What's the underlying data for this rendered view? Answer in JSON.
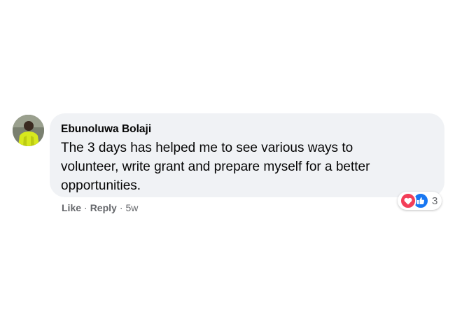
{
  "comment": {
    "author": "Ebunoluwa Bolaji",
    "text": "The 3 days has helped me to see various ways to volunteer, write grant and prepare myself for a better opportunities.",
    "avatar_icon": "profile-photo",
    "actions": {
      "like_label": "Like",
      "reply_label": "Reply",
      "separator": "·",
      "timestamp": "5w"
    },
    "reactions": {
      "icons": [
        "love-icon",
        "like-icon"
      ],
      "count": "3",
      "colors": {
        "love": "#f33e58",
        "like": "#1877f2"
      }
    },
    "bubble_color": "#f0f2f5",
    "meta_text_color": "#65676b"
  }
}
